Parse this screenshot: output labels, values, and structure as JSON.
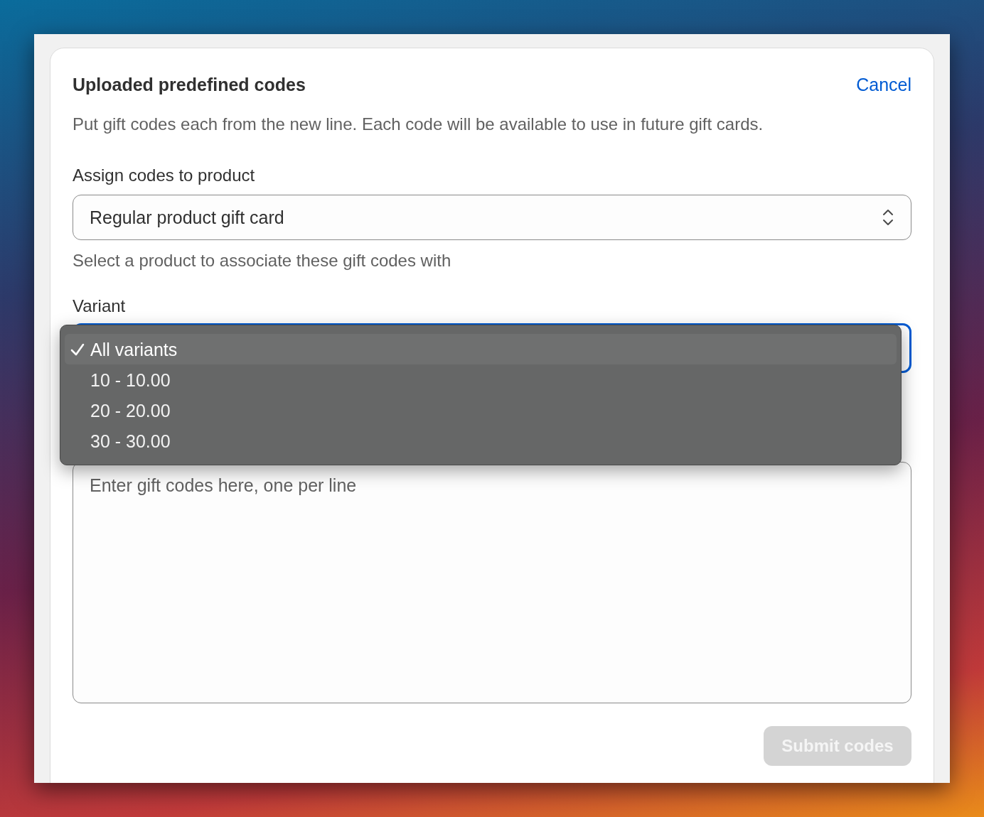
{
  "card": {
    "title": "Uploaded predefined codes",
    "cancel": "Cancel",
    "description": "Put gift codes each from the new line. Each code will be available to use in future gift cards."
  },
  "product": {
    "label": "Assign codes to product",
    "value": "Regular product gift card",
    "help": "Select a product to associate these gift codes with"
  },
  "variant": {
    "label": "Variant",
    "focused": true,
    "options": [
      {
        "label": "All variants",
        "selected": true
      },
      {
        "label": "10 - 10.00",
        "selected": false
      },
      {
        "label": "20 - 20.00",
        "selected": false
      },
      {
        "label": "30 - 30.00",
        "selected": false
      }
    ]
  },
  "codes": {
    "placeholder": "Enter gift codes here, one per line"
  },
  "submit": {
    "label": "Submit codes",
    "disabled": true
  }
}
